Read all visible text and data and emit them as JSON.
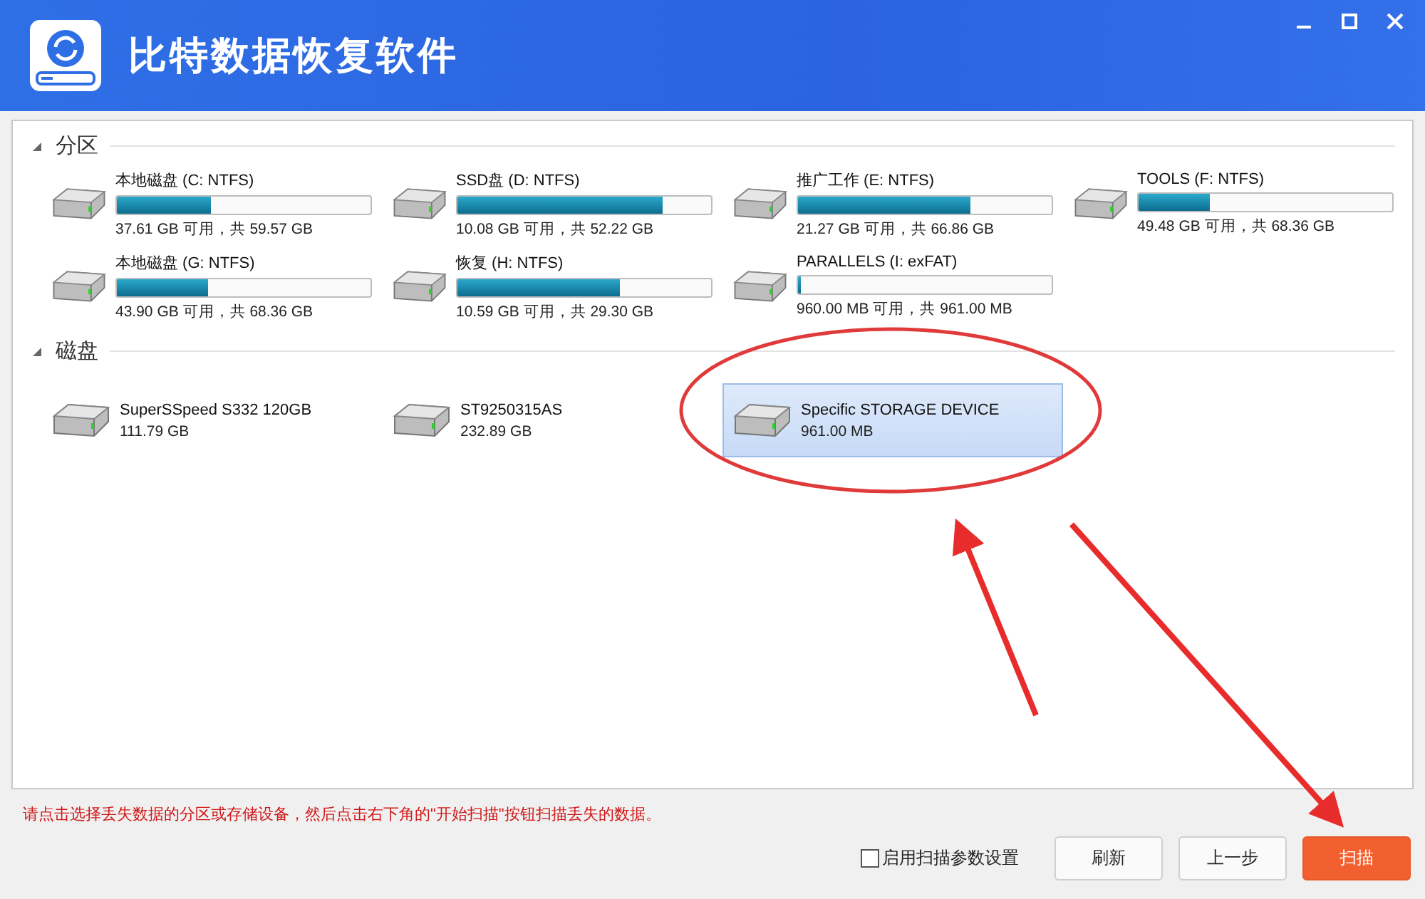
{
  "window": {
    "title": "比特数据恢复软件"
  },
  "sections": [
    {
      "title": "分区",
      "expanded": true,
      "kind": "partitions",
      "items": [
        {
          "name": "本地磁盘 (C: NTFS)",
          "level": 0.37,
          "info": "37.61 GB 可用，共 59.57 GB",
          "selected": false
        },
        {
          "name": "SSD盘 (D: NTFS)",
          "level": 0.81,
          "info": "10.08 GB 可用，共 52.22 GB",
          "selected": false
        },
        {
          "name": "推广工作 (E: NTFS)",
          "level": 0.68,
          "info": "21.27 GB 可用，共 66.86 GB",
          "selected": false
        },
        {
          "name": "TOOLS (F: NTFS)",
          "level": 0.28,
          "info": "49.48 GB 可用，共 68.36 GB",
          "selected": false
        },
        {
          "name": "本地磁盘 (G: NTFS)",
          "level": 0.36,
          "info": "43.90 GB 可用，共 68.36 GB",
          "selected": false
        },
        {
          "name": "恢复 (H: NTFS)",
          "level": 0.64,
          "info": "10.59 GB 可用，共 29.30 GB",
          "selected": false
        },
        {
          "name": "PARALLELS (I: exFAT)",
          "level": 0.01,
          "info": "960.00 MB 可用，共 961.00 MB",
          "selected": false
        }
      ]
    },
    {
      "title": "磁盘",
      "expanded": true,
      "kind": "disks",
      "items": [
        {
          "name": "SuperSSpeed S332 120GB",
          "info": "111.79 GB",
          "selected": false
        },
        {
          "name": "ST9250315AS",
          "info": "232.89 GB",
          "selected": false
        },
        {
          "name": "Specific STORAGE DEVICE",
          "info": "961.00 MB",
          "selected": true
        }
      ]
    }
  ],
  "hint": "请点击选择丢失数据的分区或存储设备，然后点击右下角的\"开始扫描\"按钮扫描丢失的数据。",
  "scan_settings": {
    "label": "启用扫描参数设置",
    "checked": false
  },
  "buttons": [
    {
      "label": "刷新",
      "kind": "normal"
    },
    {
      "label": "上一步",
      "kind": "normal"
    },
    {
      "label": "扫描",
      "kind": "primary"
    }
  ]
}
